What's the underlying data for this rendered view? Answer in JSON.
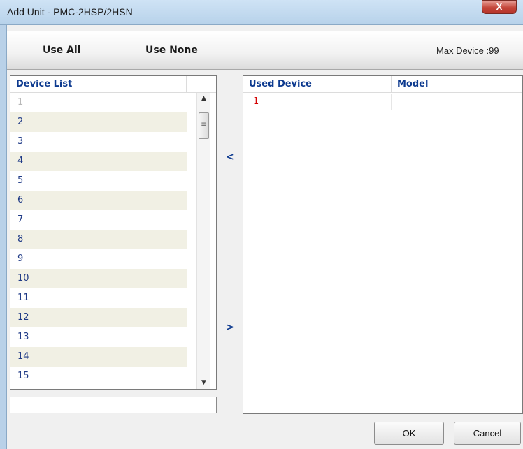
{
  "window": {
    "title": "Add Unit - PMC-2HSP/2HSN",
    "close_glyph": "X"
  },
  "toolbar": {
    "use_all_label": "Use All",
    "use_none_label": "Use None",
    "max_device_label": "Max Device :99"
  },
  "device_list": {
    "header": "Device List",
    "items": [
      "1",
      "2",
      "3",
      "4",
      "5",
      "6",
      "7",
      "8",
      "9",
      "10",
      "11",
      "12",
      "13",
      "14",
      "15"
    ]
  },
  "used_devices": {
    "header_device": "Used Device",
    "header_model": "Model",
    "rows": [
      {
        "device": "1",
        "model": ""
      }
    ]
  },
  "move": {
    "left_label": "<",
    "right_label": ">"
  },
  "buttons": {
    "ok_label": "OK",
    "cancel_label": "Cancel"
  },
  "colors": {
    "header_text": "#0d3a8f",
    "used_device_text": "#d40000",
    "alt_row": "#f1f0e4"
  }
}
